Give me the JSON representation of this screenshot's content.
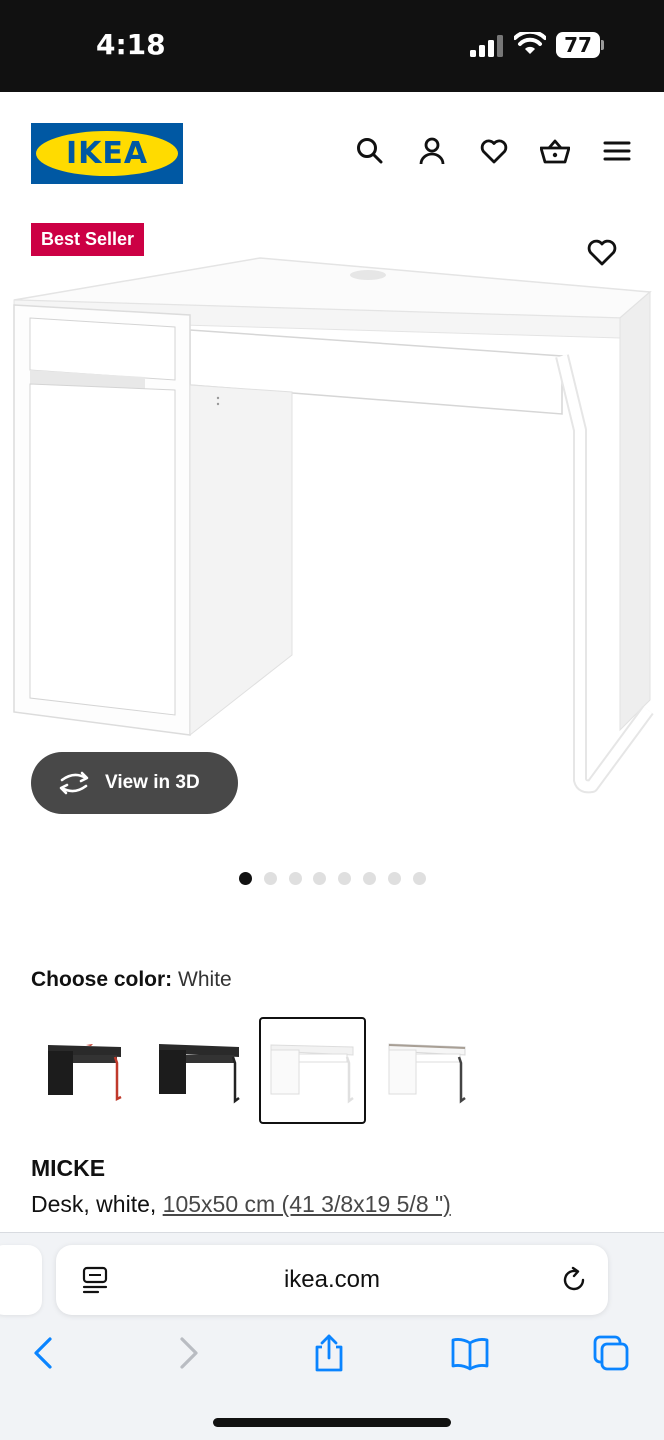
{
  "status_bar": {
    "time": "4:18",
    "battery": "77"
  },
  "header": {
    "logo": "IKEA",
    "icons": [
      "search-icon",
      "account-icon",
      "heart-icon",
      "basket-icon",
      "menu-icon"
    ]
  },
  "product": {
    "badge": "Best Seller",
    "view_3d_label": "View in 3D",
    "image_count": 8,
    "active_image": 1,
    "color_label": "Choose color:",
    "color_value": "White",
    "swatches": [
      "black-brown/red",
      "black-brown",
      "white",
      "white/anthracite"
    ],
    "selected_swatch": 2,
    "name": "MICKE",
    "desc_prefix": "Desk, white, ",
    "desc_size": "105x50 cm (41 3/8x19 5/8 \")"
  },
  "browser": {
    "url": "ikea.com"
  },
  "colors": {
    "ikea_blue": "#0058a3",
    "ikea_yellow": "#ffdb00",
    "badge_red": "#cc0044",
    "button_dark": "#484848",
    "ios_blue": "#0a84ff"
  }
}
